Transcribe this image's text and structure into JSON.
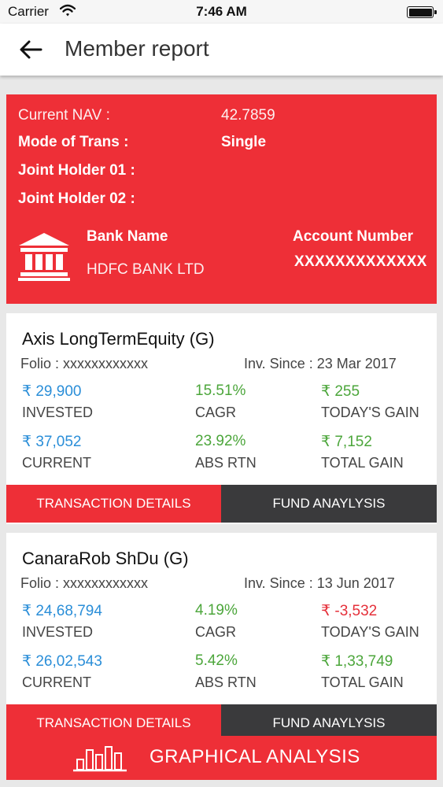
{
  "status_bar": {
    "carrier": "Carrier",
    "time": "7:46 AM"
  },
  "header": {
    "title": "Member report"
  },
  "summary": {
    "nav_label": "Current NAV :",
    "nav_value": "42.7859",
    "mode_label": "Mode of Trans :",
    "mode_value": "Single",
    "joint1_label": "Joint Holder 01 :",
    "joint2_label": "Joint Holder 02 :",
    "bank_name_label": "Bank Name",
    "bank_name_value": "HDFC BANK LTD",
    "account_label": "Account Number",
    "account_value": "XXXXXXXXXXXXX"
  },
  "funds": [
    {
      "name": "Axis LongTermEquity (G)",
      "folio": "Folio : xxxxxxxxxxxx",
      "since": "Inv. Since : 23 Mar 2017",
      "invested": "₹ 29,900",
      "invested_label": "INVESTED",
      "cagr": "15.51%",
      "cagr_label": "CAGR",
      "today_gain": "₹ 255",
      "today_gain_label": "TODAY'S GAIN",
      "current": "₹ 37,052",
      "current_label": "CURRENT",
      "abs_rtn": "23.92%",
      "abs_rtn_label": "ABS RTN",
      "total_gain": "₹ 7,152",
      "total_gain_label": "TOTAL GAIN",
      "txn_button": "TRANSACTION DETAILS",
      "fund_button": "FUND ANAYLYSIS"
    },
    {
      "name": "CanaraRob ShDu (G)",
      "folio": "Folio : xxxxxxxxxxxx",
      "since": "Inv. Since : 13 Jun 2017",
      "invested": "₹ 24,68,794",
      "invested_label": "INVESTED",
      "cagr": "4.19%",
      "cagr_label": "CAGR",
      "today_gain": "₹ -3,532",
      "today_gain_label": "TODAY'S GAIN",
      "current": "₹ 26,02,543",
      "current_label": "CURRENT",
      "abs_rtn": "5.42%",
      "abs_rtn_label": "ABS RTN",
      "total_gain": "₹ 1,33,749",
      "total_gain_label": "TOTAL GAIN",
      "txn_button": "TRANSACTION DETAILS",
      "fund_button": "FUND ANAYLYSIS"
    }
  ],
  "graph_button": {
    "label": "GRAPHICAL ANALYSIS"
  },
  "colors": {
    "brand_red": "#ee2f37",
    "dark_button": "#3a3a3c",
    "positive": "#4ca63b",
    "value_blue": "#2a8ed8",
    "negative": "#e5303a"
  },
  "icons": [
    "wifi-icon",
    "battery-icon",
    "back-arrow-icon",
    "bank-icon",
    "bar-chart-icon"
  ]
}
